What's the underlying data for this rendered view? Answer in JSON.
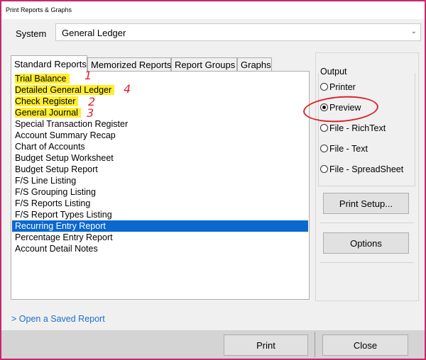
{
  "window": {
    "title": "Print Reports & Graphs"
  },
  "system": {
    "label": "System",
    "value": "General Ledger"
  },
  "tabs": [
    {
      "label": "Standard Reports",
      "active": true
    },
    {
      "label": "Memorized Reports",
      "active": false
    },
    {
      "label": "Report Groups",
      "active": false
    },
    {
      "label": "Graphs",
      "active": false
    }
  ],
  "reports": [
    {
      "label": "Trial Balance",
      "highlighted": true,
      "annotation": "1"
    },
    {
      "label": "Detailed General Ledger",
      "highlighted": true,
      "annotation": "4"
    },
    {
      "label": "Check Register",
      "highlighted": true,
      "annotation": "2"
    },
    {
      "label": "General Journal",
      "highlighted": true,
      "annotation": "3"
    },
    {
      "label": "Special Transaction Register"
    },
    {
      "label": "Account Summary Recap"
    },
    {
      "label": "Chart of Accounts"
    },
    {
      "label": "Budget Setup Worksheet"
    },
    {
      "label": "Budget Setup Report"
    },
    {
      "label": "F/S Line Listing"
    },
    {
      "label": "F/S Grouping Listing"
    },
    {
      "label": "F/S Reports Listing"
    },
    {
      "label": "F/S Report Types Listing"
    },
    {
      "label": "Recurring Entry Report",
      "selected": true
    },
    {
      "label": "Percentage Entry Report"
    },
    {
      "label": "Account Detail Notes"
    }
  ],
  "output": {
    "label": "Output",
    "options": [
      {
        "label": "Printer",
        "checked": false
      },
      {
        "label": "Preview",
        "checked": true
      },
      {
        "label": "File - RichText",
        "checked": false
      },
      {
        "label": "File - Text",
        "checked": false
      },
      {
        "label": "File - SpreadSheet",
        "checked": false
      }
    ]
  },
  "buttons": {
    "print_setup": "Print Setup...",
    "options": "Options",
    "print": "Print",
    "close": "Close"
  },
  "open_saved": "> Open a Saved Report",
  "colors": {
    "highlight": "#ffee2a",
    "selection": "#0a68d0",
    "annotation": "#e0202a",
    "border": "#c6286d"
  }
}
